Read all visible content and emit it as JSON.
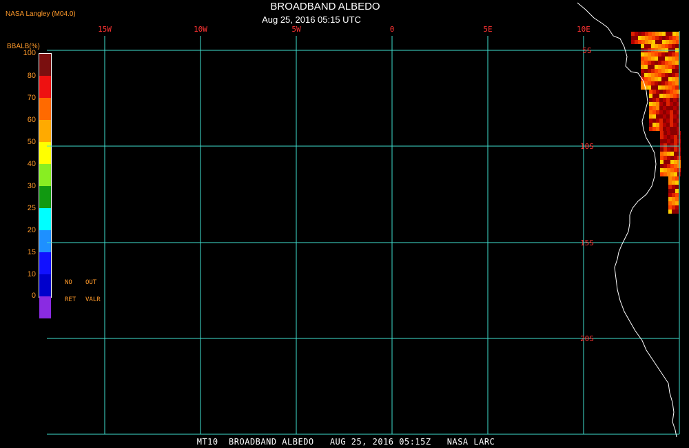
{
  "header": {
    "credit": "NASA Langley (M04.0)",
    "title": "BROADBAND ALBEDO",
    "subtitle": "Aug 25, 2016 05:15 UTC"
  },
  "legend": {
    "title": "BBALB(%)",
    "ticks": [
      "100",
      "80",
      "70",
      "60",
      "50",
      "40",
      "30",
      "25",
      "20",
      "15",
      "10",
      "0"
    ],
    "colors": [
      "#7a0f0f",
      "#ee1111",
      "#ff6a00",
      "#ffaa00",
      "#ffff00",
      "#88ee22",
      "#119911",
      "#00ffff",
      "#1e90ff",
      "#1111ff",
      "#0000cc",
      "#8a2be2"
    ],
    "notes": {
      "no": "NO",
      "out": "OUT",
      "ret": "RET",
      "valr": "VALR"
    }
  },
  "map": {
    "lon_labels": [
      "15W",
      "10W",
      "5W",
      "0",
      "5E",
      "10E"
    ],
    "lat_labels": [
      "5S",
      "10S",
      "15S",
      "20S"
    ],
    "grid_color": "#40e0d0",
    "label_color": "#ff3333",
    "coast_color": "#ffffff"
  },
  "footer": "MT10  BROADBAND ALBEDO   AUG 25, 2016 05:15Z   NASA LARC"
}
